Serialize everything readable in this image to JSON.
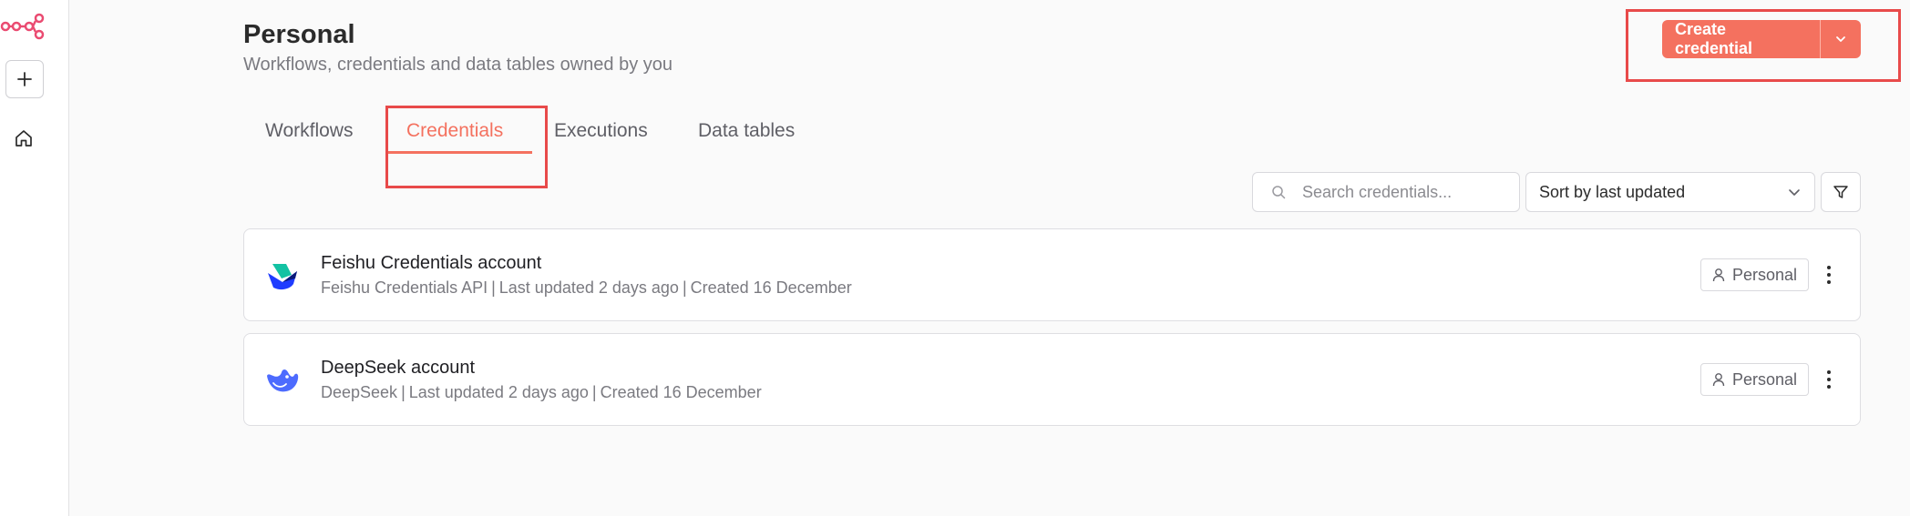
{
  "header": {
    "title": "Personal",
    "subtitle": "Workflows, credentials and data tables owned by you",
    "create_label": "Create credential"
  },
  "tabs": [
    {
      "label": "Workflows"
    },
    {
      "label": "Credentials"
    },
    {
      "label": "Executions"
    },
    {
      "label": "Data tables"
    }
  ],
  "active_tab": "Credentials",
  "toolbar": {
    "search_placeholder": "Search credentials...",
    "search_value": "",
    "sort_label": "Sort by last updated"
  },
  "credentials": [
    {
      "name": "Feishu Credentials account",
      "type": "Feishu Credentials API",
      "updated": "Last updated 2 days ago",
      "created": "Created 16 December",
      "owner": "Personal",
      "icon": "feishu-icon"
    },
    {
      "name": "DeepSeek account",
      "type": "DeepSeek",
      "updated": "Last updated 2 days ago",
      "created": "Created 16 December",
      "owner": "Personal",
      "icon": "deepseek-icon"
    }
  ],
  "colors": {
    "accent": "#f4715f",
    "highlight": "#e84a4a",
    "logo": "#ea4b71"
  }
}
